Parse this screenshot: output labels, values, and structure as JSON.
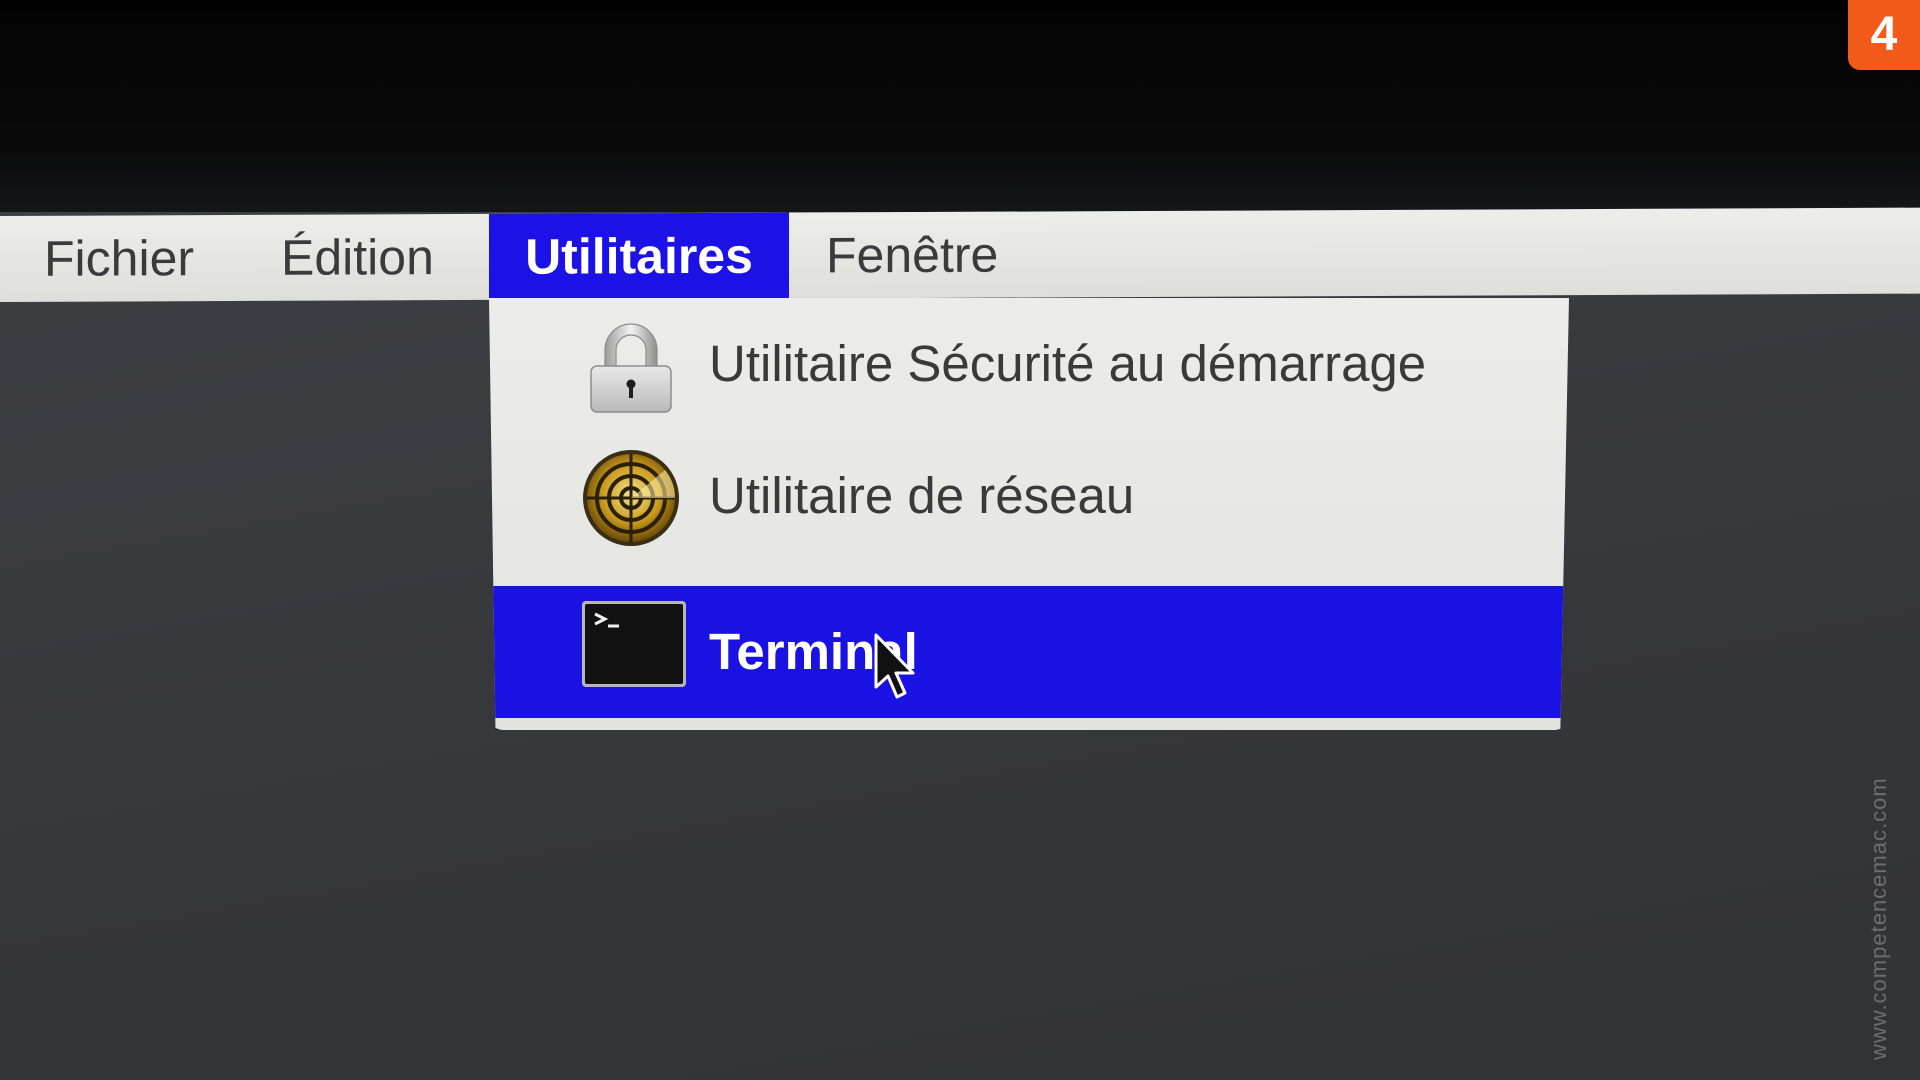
{
  "menubar": {
    "items": [
      {
        "label": "Fichier"
      },
      {
        "label": "Édition"
      },
      {
        "label": "Utilitaires"
      },
      {
        "label": "Fenêtre"
      }
    ],
    "active_label": "Utilitaires",
    "highlight_color": "#1c12e6"
  },
  "dropdown": {
    "items": [
      {
        "label": "Utilitaire Sécurité au démarrage",
        "icon": "padlock-icon"
      },
      {
        "label": "Utilitaire de réseau",
        "icon": "radar-icon"
      },
      {
        "label": "Terminal",
        "icon": "terminal-icon",
        "highlighted": true
      }
    ]
  },
  "step_badge": {
    "label": "4",
    "color": "#f25a1a"
  },
  "watermark": "www.competencemac.com",
  "cursor_icon": "arrow-cursor-icon"
}
